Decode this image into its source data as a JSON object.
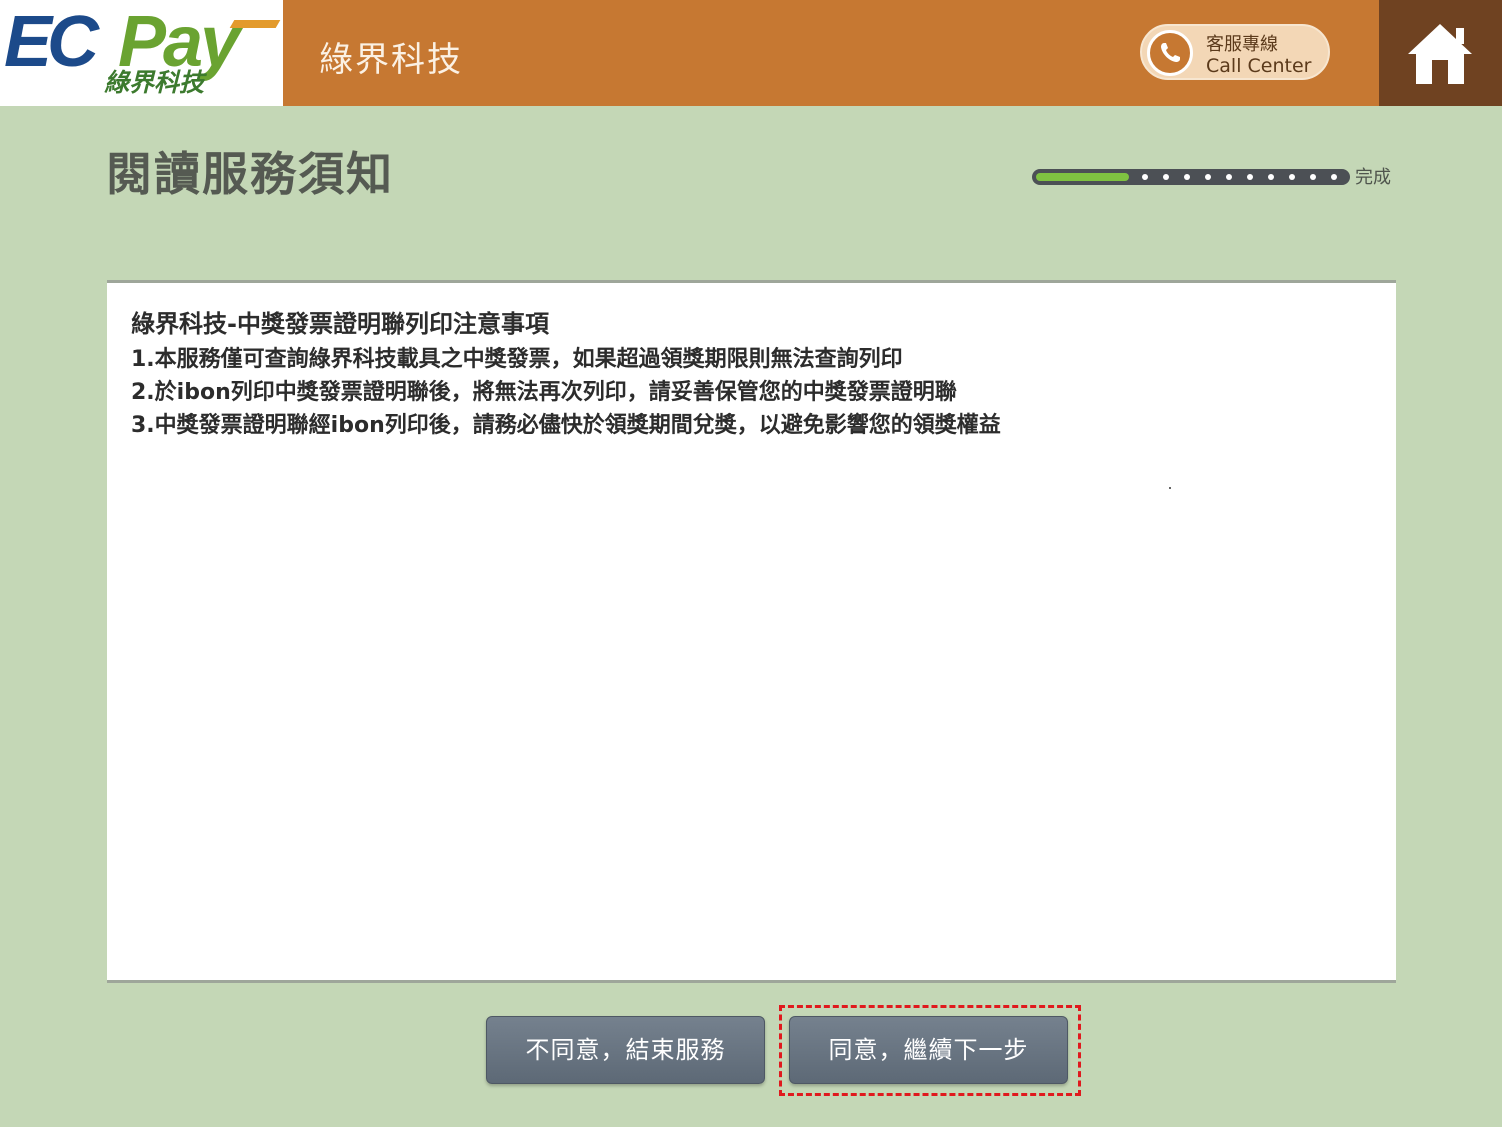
{
  "header": {
    "logo": {
      "main": "EC",
      "accent": "Pay",
      "sub": "綠界科技"
    },
    "brand_name": "綠界科技",
    "call_center": {
      "label_zh": "客服專線",
      "label_en": "Call Center",
      "icon": "phone-icon"
    },
    "home_icon": "home-icon",
    "colors": {
      "brand_bar": "#c67832",
      "home_box": "#6f4221"
    }
  },
  "page": {
    "title": "閱讀服務須知",
    "progress": {
      "fraction": 0.3,
      "label": "完成",
      "dot_count": 10
    }
  },
  "notice": {
    "title": "綠界科技-中獎發票證明聯列印注意事項",
    "items": [
      "1.本服務僅可查詢綠界科技載具之中獎發票，如果超過領獎期限則無法查詢列印",
      "2.於ibon列印中獎發票證明聯後，將無法再次列印，請妥善保管您的中獎發票證明聯",
      "3.中獎發票證明聯經ibon列印後，請務必儘快於領獎期間兌獎，以避免影響您的領獎權益"
    ]
  },
  "actions": {
    "disagree_label": "不同意，結束服務",
    "agree_label": "同意，繼續下一步",
    "highlight_color": "#e0191d"
  }
}
